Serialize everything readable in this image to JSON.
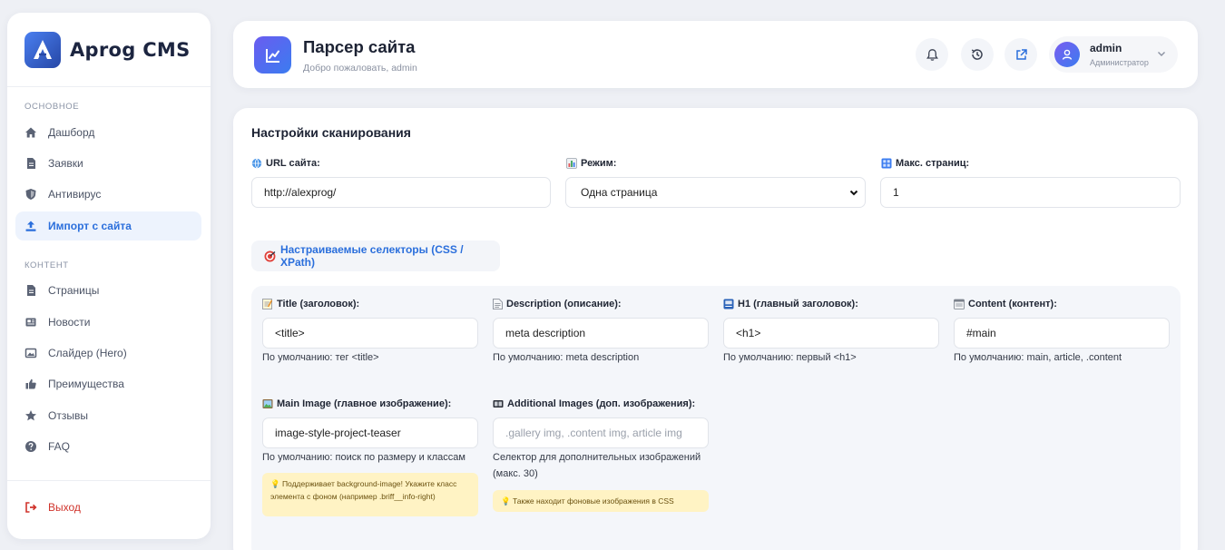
{
  "brand": {
    "name": "Aprog CMS"
  },
  "sidebar": {
    "sections": {
      "main": "ОСНОВНОЕ",
      "content": "КОНТЕНТ"
    },
    "items": [
      {
        "label": "Дашборд",
        "icon": "home-icon"
      },
      {
        "label": "Заявки",
        "icon": "document-icon"
      },
      {
        "label": "Антивирус",
        "icon": "shield-icon"
      },
      {
        "label": "Импорт с сайта",
        "icon": "upload-icon",
        "active": true
      },
      {
        "label": "Страницы",
        "icon": "page-icon"
      },
      {
        "label": "Новости",
        "icon": "newspaper-icon"
      },
      {
        "label": "Слайдер (Hero)",
        "icon": "image-icon"
      },
      {
        "label": "Преимущества",
        "icon": "thumbs-up-icon"
      },
      {
        "label": "Отзывы",
        "icon": "star-icon"
      },
      {
        "label": "FAQ",
        "icon": "question-icon"
      }
    ],
    "logout": "Выход"
  },
  "header": {
    "title": "Парсер сайта",
    "subtitle": "Добро пожаловать, admin",
    "user": {
      "name": "admin",
      "role": "Администратор"
    }
  },
  "scan": {
    "title": "Настройки сканирования",
    "url": {
      "label": "URL сайта:",
      "value": "http://alexprog/"
    },
    "mode": {
      "label": "Режим:",
      "value": "Одна страница"
    },
    "max_pages": {
      "label": "Макс. страниц:",
      "value": "1"
    },
    "selectors_toggle": "Настраиваемые селекторы (CSS / XPath)"
  },
  "selectors": {
    "title": {
      "label": "Title (заголовок):",
      "value": "<title>",
      "hint": "По умолчанию: тег <title>"
    },
    "description": {
      "label": "Description (описание):",
      "value": "meta description",
      "hint": "По умолчанию: meta description"
    },
    "h1": {
      "label": "H1 (главный заголовок):",
      "value": "<h1>",
      "hint": "По умолчанию: первый <h1>"
    },
    "content": {
      "label": "Content (контент):",
      "value": "#main",
      "hint": "По умолчанию: main, article, .content"
    },
    "main_image": {
      "label": "Main Image (главное изображение):",
      "value": "image-style-project-teaser",
      "hint": "По умолчанию: поиск по размеру и классам",
      "note": "💡 Поддерживает background-image! Укажите класс элемента с фоном (например .briff__info-right)"
    },
    "additional_images": {
      "label": "Additional Images (доп. изображения):",
      "placeholder": ".gallery img, .content img, article img",
      "hint": "Селектор для дополнительных изображений (макс. 30)",
      "note": "💡 Также находит фоновые изображения в CSS"
    }
  },
  "colors": {
    "accent": "#2b6fdc",
    "danger": "#d0342c",
    "note_bg": "#fff3c4"
  }
}
